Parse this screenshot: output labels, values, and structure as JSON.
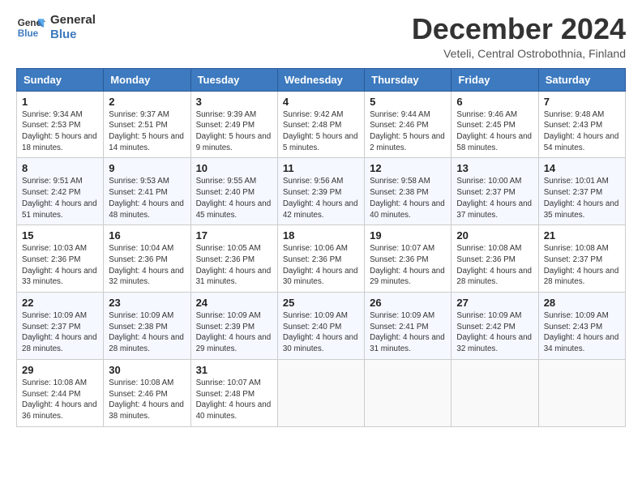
{
  "logo": {
    "line1": "General",
    "line2": "Blue"
  },
  "title": "December 2024",
  "subtitle": "Veteli, Central Ostrobothnia, Finland",
  "days_of_week": [
    "Sunday",
    "Monday",
    "Tuesday",
    "Wednesday",
    "Thursday",
    "Friday",
    "Saturday"
  ],
  "weeks": [
    [
      {
        "day": 1,
        "sunrise": "9:34 AM",
        "sunset": "2:53 PM",
        "daylight": "5 hours and 18 minutes."
      },
      {
        "day": 2,
        "sunrise": "9:37 AM",
        "sunset": "2:51 PM",
        "daylight": "5 hours and 14 minutes."
      },
      {
        "day": 3,
        "sunrise": "9:39 AM",
        "sunset": "2:49 PM",
        "daylight": "5 hours and 9 minutes."
      },
      {
        "day": 4,
        "sunrise": "9:42 AM",
        "sunset": "2:48 PM",
        "daylight": "5 hours and 5 minutes."
      },
      {
        "day": 5,
        "sunrise": "9:44 AM",
        "sunset": "2:46 PM",
        "daylight": "5 hours and 2 minutes."
      },
      {
        "day": 6,
        "sunrise": "9:46 AM",
        "sunset": "2:45 PM",
        "daylight": "4 hours and 58 minutes."
      },
      {
        "day": 7,
        "sunrise": "9:48 AM",
        "sunset": "2:43 PM",
        "daylight": "4 hours and 54 minutes."
      }
    ],
    [
      {
        "day": 8,
        "sunrise": "9:51 AM",
        "sunset": "2:42 PM",
        "daylight": "4 hours and 51 minutes."
      },
      {
        "day": 9,
        "sunrise": "9:53 AM",
        "sunset": "2:41 PM",
        "daylight": "4 hours and 48 minutes."
      },
      {
        "day": 10,
        "sunrise": "9:55 AM",
        "sunset": "2:40 PM",
        "daylight": "4 hours and 45 minutes."
      },
      {
        "day": 11,
        "sunrise": "9:56 AM",
        "sunset": "2:39 PM",
        "daylight": "4 hours and 42 minutes."
      },
      {
        "day": 12,
        "sunrise": "9:58 AM",
        "sunset": "2:38 PM",
        "daylight": "4 hours and 40 minutes."
      },
      {
        "day": 13,
        "sunrise": "10:00 AM",
        "sunset": "2:37 PM",
        "daylight": "4 hours and 37 minutes."
      },
      {
        "day": 14,
        "sunrise": "10:01 AM",
        "sunset": "2:37 PM",
        "daylight": "4 hours and 35 minutes."
      }
    ],
    [
      {
        "day": 15,
        "sunrise": "10:03 AM",
        "sunset": "2:36 PM",
        "daylight": "4 hours and 33 minutes."
      },
      {
        "day": 16,
        "sunrise": "10:04 AM",
        "sunset": "2:36 PM",
        "daylight": "4 hours and 32 minutes."
      },
      {
        "day": 17,
        "sunrise": "10:05 AM",
        "sunset": "2:36 PM",
        "daylight": "4 hours and 31 minutes."
      },
      {
        "day": 18,
        "sunrise": "10:06 AM",
        "sunset": "2:36 PM",
        "daylight": "4 hours and 30 minutes."
      },
      {
        "day": 19,
        "sunrise": "10:07 AM",
        "sunset": "2:36 PM",
        "daylight": "4 hours and 29 minutes."
      },
      {
        "day": 20,
        "sunrise": "10:08 AM",
        "sunset": "2:36 PM",
        "daylight": "4 hours and 28 minutes."
      },
      {
        "day": 21,
        "sunrise": "10:08 AM",
        "sunset": "2:37 PM",
        "daylight": "4 hours and 28 minutes."
      }
    ],
    [
      {
        "day": 22,
        "sunrise": "10:09 AM",
        "sunset": "2:37 PM",
        "daylight": "4 hours and 28 minutes."
      },
      {
        "day": 23,
        "sunrise": "10:09 AM",
        "sunset": "2:38 PM",
        "daylight": "4 hours and 28 minutes."
      },
      {
        "day": 24,
        "sunrise": "10:09 AM",
        "sunset": "2:39 PM",
        "daylight": "4 hours and 29 minutes."
      },
      {
        "day": 25,
        "sunrise": "10:09 AM",
        "sunset": "2:40 PM",
        "daylight": "4 hours and 30 minutes."
      },
      {
        "day": 26,
        "sunrise": "10:09 AM",
        "sunset": "2:41 PM",
        "daylight": "4 hours and 31 minutes."
      },
      {
        "day": 27,
        "sunrise": "10:09 AM",
        "sunset": "2:42 PM",
        "daylight": "4 hours and 32 minutes."
      },
      {
        "day": 28,
        "sunrise": "10:09 AM",
        "sunset": "2:43 PM",
        "daylight": "4 hours and 34 minutes."
      }
    ],
    [
      {
        "day": 29,
        "sunrise": "10:08 AM",
        "sunset": "2:44 PM",
        "daylight": "4 hours and 36 minutes."
      },
      {
        "day": 30,
        "sunrise": "10:08 AM",
        "sunset": "2:46 PM",
        "daylight": "4 hours and 38 minutes."
      },
      {
        "day": 31,
        "sunrise": "10:07 AM",
        "sunset": "2:48 PM",
        "daylight": "4 hours and 40 minutes."
      },
      null,
      null,
      null,
      null
    ]
  ]
}
